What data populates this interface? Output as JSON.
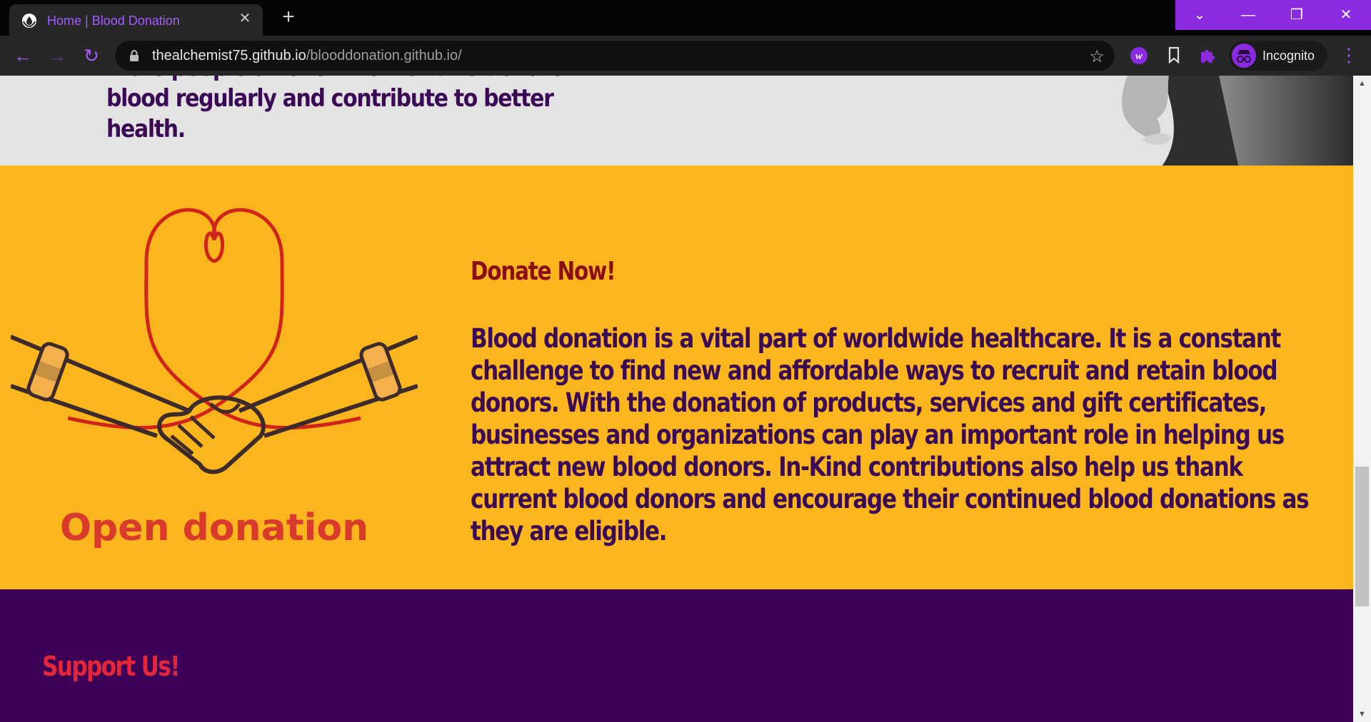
{
  "browser": {
    "tab_title": "Home | Blood Donation",
    "tab_close": "✕",
    "new_tab": "+",
    "url_host": "thealchemist75.github.io",
    "url_path": "/blooddonation.github.io/",
    "profile_label": "Incognito",
    "window_controls": {
      "tab_search": "⌄",
      "minimize": "—",
      "restore": "❐",
      "close": "✕"
    },
    "accent_color": "#8a2be2"
  },
  "page": {
    "intro_text": "more people all over the world to donate blood regularly and contribute to better health.",
    "donate_section": {
      "illustration_caption": "Open donation",
      "title": "Donate Now!",
      "body": "Blood donation is a vital part of worldwide healthcare. It is a constant challenge to find new and affordable ways to recruit and retain blood donors. With the donation of products, services and gift certificates, businesses and organizations can play an important role in helping us attract new blood donors. In-Kind contributions also help us thank current blood donors and encourage their continued blood donations as they are eligible.",
      "background_color": "#fcb61d"
    },
    "support_section": {
      "title": "Support Us!",
      "background_color": "#3d0057"
    }
  }
}
